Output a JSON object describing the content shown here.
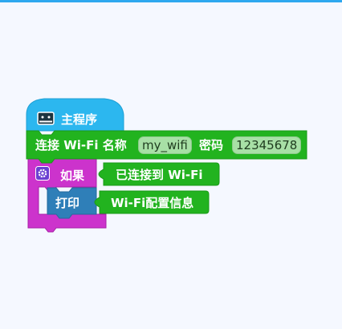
{
  "colors": {
    "workspace_bg": "#f5f8ff",
    "top_accent": "#2ea8ef",
    "hat_block": "#2cb7ef",
    "wifi_block": "#22b31f",
    "if_block": "#cc33cc",
    "print_block": "#2f7fb8",
    "field_bg": "#a8e0a6"
  },
  "program": {
    "main_block": {
      "label": "主程序",
      "icon": "microbit-board-icon"
    },
    "connect_wifi_block": {
      "label_prefix": "连接 Wi-Fi 名称",
      "ssid_value": "my_wifi",
      "label_password": "密码",
      "password_value": "12345678"
    },
    "if_block": {
      "label": "如果",
      "icon": "gear-icon",
      "condition_label": "已连接到 Wi-Fi"
    },
    "print_block": {
      "label": "打印",
      "argument_label": "Wi-Fi配置信息"
    }
  }
}
